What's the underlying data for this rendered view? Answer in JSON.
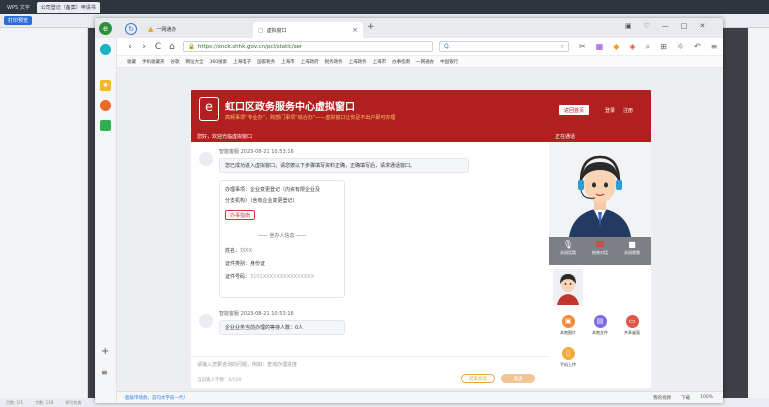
{
  "wps": {
    "tabs": [
      "WPS 文字",
      "公司登记（备案）申请书"
    ],
    "print_label": "打印预览",
    "status_items": [
      "页数: 1/1",
      "字数: 118",
      "拼写检查"
    ]
  },
  "browser": {
    "tab1": "一网通办",
    "tab2": "虚拟窗口",
    "url": "https://xnck.shhk.gov.cn/pcl/static/ser",
    "bookmarks": [
      "收藏",
      "手机收藏夹",
      "谷歌",
      "网址大全",
      "360搜索",
      "上海电子",
      "国家税务",
      "上海市",
      "上海政府",
      "税务政务",
      "上海政务",
      "上海市",
      "办事指南",
      "一网通办",
      "中国银行"
    ],
    "bottom_left": "超级市场款，首句文字前一代！",
    "bottom_items": [
      "我的视频",
      "下载",
      "100%"
    ]
  },
  "page": {
    "title": "虹口区政务服务中心虚拟窗口",
    "subtitle": "高频事项“专业办”，跨部门事项“综合办”——虚拟窗口让你足不出户即可办理",
    "btn_back": "返回首页",
    "btn_login": "登录",
    "btn_register": "注册"
  },
  "chat": {
    "header": "您好，欢迎光临虚拟窗口",
    "msg1_meta": "智能客服 2023-08-21 10:53:16",
    "msg1_text": "您已成功进入虚拟窗口，请您按以下步骤填写资料正确，正确填写后，请求通话窗口。",
    "card_line1": "办理事项：企业变更登记（内资有限企业及",
    "card_line2": "分支机构）（含有企业变更登记）",
    "card_btn": "办事指南",
    "agent_divider": "——  坐办人信息  ——",
    "agent_name_label": "姓名：",
    "agent_name_value": "刘XX",
    "agent_id_type_label": "证件类别：",
    "agent_id_type_value": "身份证",
    "agent_id_no_label": "证件号码：",
    "agent_id_no_value": "3101XXXXXXXXXXXXXXX",
    "msg2_meta": "智能客服 2023-08-21 10:53:16",
    "msg2_text": "企业业务当前办理的等待人数：0人",
    "input_placeholder": "请输入您要咨询的问题，例如：查询办理进度",
    "char_count": "当前输入字数：0/500",
    "btn_end": "结束会话",
    "btn_send": "发送"
  },
  "video": {
    "header": "正在通话",
    "ctrl_mic": "关闭话筒",
    "ctrl_hangup": "结束对话",
    "ctrl_cam": "关闭视频"
  },
  "panel": {
    "items": [
      {
        "label": "本地图片",
        "color": "#f08a3c"
      },
      {
        "label": "本地文件",
        "color": "#7b6be0"
      },
      {
        "label": "共享桌面",
        "color": "#e0574b"
      },
      {
        "label": "手机上传",
        "color": "#f3a93c"
      }
    ]
  }
}
